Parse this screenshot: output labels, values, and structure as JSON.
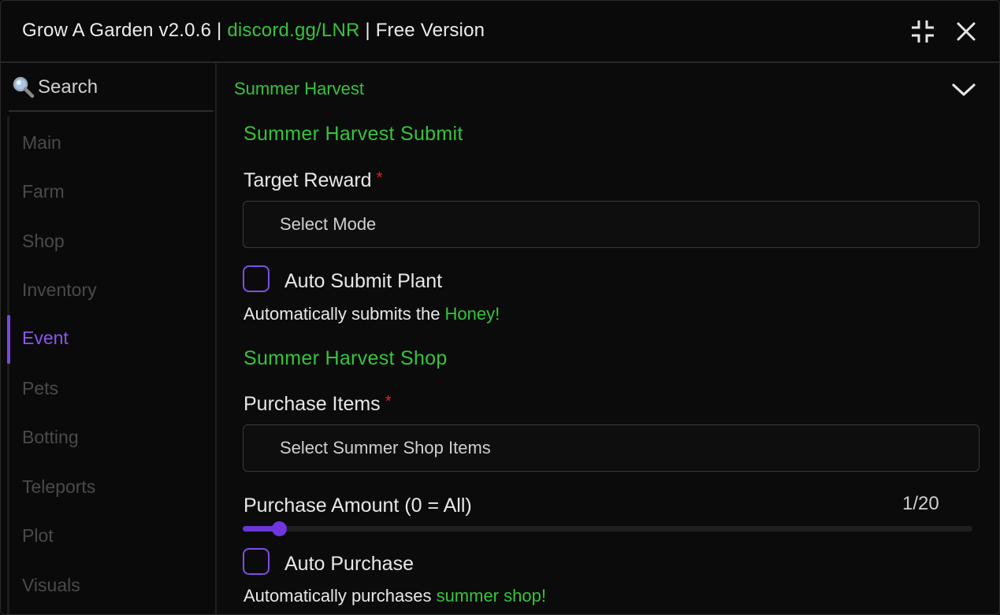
{
  "window": {
    "title_prefix": "Grow A Garden v2.0.6 | ",
    "title_link": "discord.gg/LNR",
    "title_suffix": " | Free Version",
    "minimize_icon": "collapse-icon",
    "close_icon": "close-icon"
  },
  "sidebar": {
    "search_placeholder": "Search",
    "items": [
      {
        "label": "Main"
      },
      {
        "label": "Farm"
      },
      {
        "label": "Shop"
      },
      {
        "label": "Inventory"
      },
      {
        "label": "Event"
      },
      {
        "label": "Pets"
      },
      {
        "label": "Botting"
      },
      {
        "label": "Teleports"
      },
      {
        "label": "Plot"
      },
      {
        "label": "Visuals"
      }
    ],
    "active": "Event"
  },
  "content": {
    "section_title": "Summer Harvest",
    "submit": {
      "heading": "Summer Harvest Submit",
      "target_label": "Target Reward",
      "required_mark": "*",
      "target_dropdown": "Select Mode",
      "auto_submit_label": "Auto Submit Plant",
      "auto_submit_checked": false,
      "auto_submit_desc": "Automatically submits the ",
      "auto_submit_desc_highlight": "Honey!"
    },
    "shop": {
      "heading": "Summer Harvest Shop",
      "purchase_label": "Purchase Items",
      "required_mark": "*",
      "purchase_dropdown": "Select Summer Shop Items",
      "amount_label": "Purchase Amount (0 = All)",
      "amount_value": "1/20",
      "amount_current": 1,
      "amount_max": 20,
      "auto_purchase_label": "Auto Purchase",
      "auto_purchase_checked": false,
      "auto_purchase_desc": "Automatically purchases ",
      "auto_purchase_desc_highlight": "summer shop!"
    }
  },
  "colors": {
    "accent_green": "#35c43b",
    "accent_purple": "#7a47e6",
    "required_red": "#e02424"
  }
}
